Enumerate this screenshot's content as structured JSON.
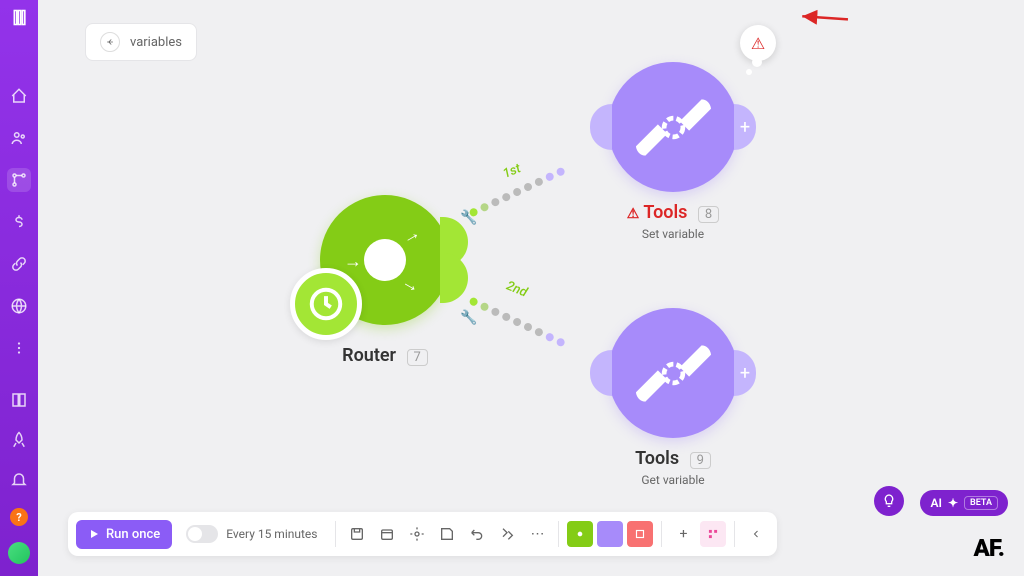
{
  "breadcrumb": {
    "label": "variables"
  },
  "nodes": {
    "router": {
      "title": "Router",
      "badge": "7"
    },
    "tools1": {
      "title": "Tools",
      "badge": "8",
      "subtitle": "Set variable",
      "hasError": true
    },
    "tools2": {
      "title": "Tools",
      "badge": "9",
      "subtitle": "Get variable",
      "hasError": false
    }
  },
  "paths": {
    "p1": "1st",
    "p2": "2nd"
  },
  "toolbar": {
    "run": "Run once",
    "schedule": "Every 15 minutes"
  },
  "ai": {
    "label": "AI",
    "beta": "BETA"
  },
  "watermark": "AF.",
  "icons": {
    "warning": "⚠"
  }
}
